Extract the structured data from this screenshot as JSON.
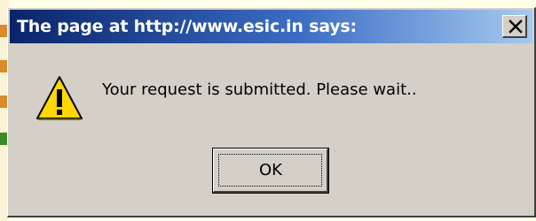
{
  "dialog": {
    "title": "The page at http://www.esic.in says:",
    "message": "Your request is submitted. Please wait..",
    "ok_label": "OK",
    "close_symbol": "X",
    "icon": "warning-icon"
  },
  "colors": {
    "titlebar_start": "#0a246a",
    "titlebar_end": "#a6caf0",
    "dialog_face": "#d4d0c8",
    "warning_fill": "#ffd800"
  }
}
